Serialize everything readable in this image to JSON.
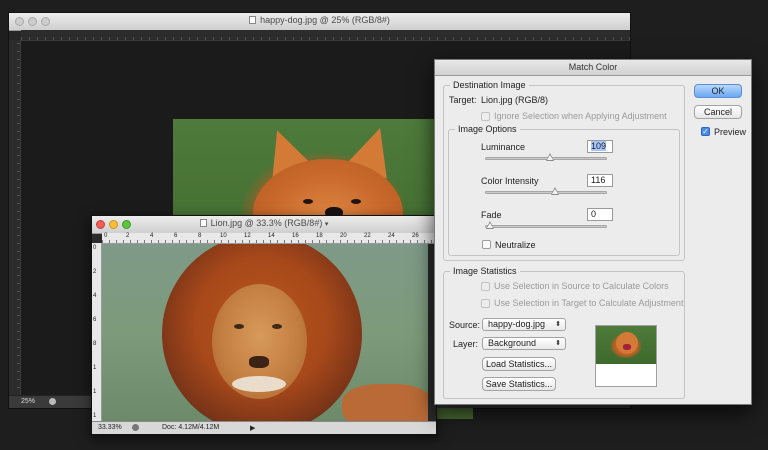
{
  "dog_window": {
    "title": "happy-dog.jpg @ 25% (RGB/8#)",
    "zoom": "25%"
  },
  "lion_window": {
    "title": "Lion.jpg @ 33.3% (RGB/8#)",
    "zoom": "33.33%",
    "doc_info": "Doc: 4.12M/4.12M",
    "ruler_top": [
      "0",
      "2",
      "4",
      "6",
      "8",
      "10",
      "12",
      "14",
      "16",
      "18",
      "20",
      "22",
      "24",
      "26"
    ],
    "ruler_left": [
      "0",
      "2",
      "4",
      "6",
      "8",
      "1",
      "1",
      "1"
    ]
  },
  "dialog": {
    "title": "Match Color",
    "destination": {
      "group_label": "Destination Image",
      "target_label": "Target:",
      "target_value": "Lion.jpg (RGB/8)",
      "ignore_selection_label": "Ignore Selection when Applying Adjustment"
    },
    "options": {
      "group_label": "Image Options",
      "luminance_label": "Luminance",
      "luminance_value": "109",
      "luminance_fraction": 0.54,
      "color_intensity_label": "Color Intensity",
      "color_intensity_value": "116",
      "color_intensity_fraction": 0.58,
      "fade_label": "Fade",
      "fade_value": "0",
      "fade_fraction": 0.0,
      "neutralize_label": "Neutralize"
    },
    "statistics": {
      "group_label": "Image Statistics",
      "use_source_label": "Use Selection in Source to Calculate Colors",
      "use_target_label": "Use Selection in Target to Calculate Adjustment",
      "source_label": "Source:",
      "source_value": "happy-dog.jpg",
      "layer_label": "Layer:",
      "layer_value": "Background",
      "load_button": "Load Statistics...",
      "save_button": "Save Statistics..."
    },
    "ok_button": "OK",
    "cancel_button": "Cancel",
    "preview_label": "Preview",
    "preview_checked": true
  }
}
